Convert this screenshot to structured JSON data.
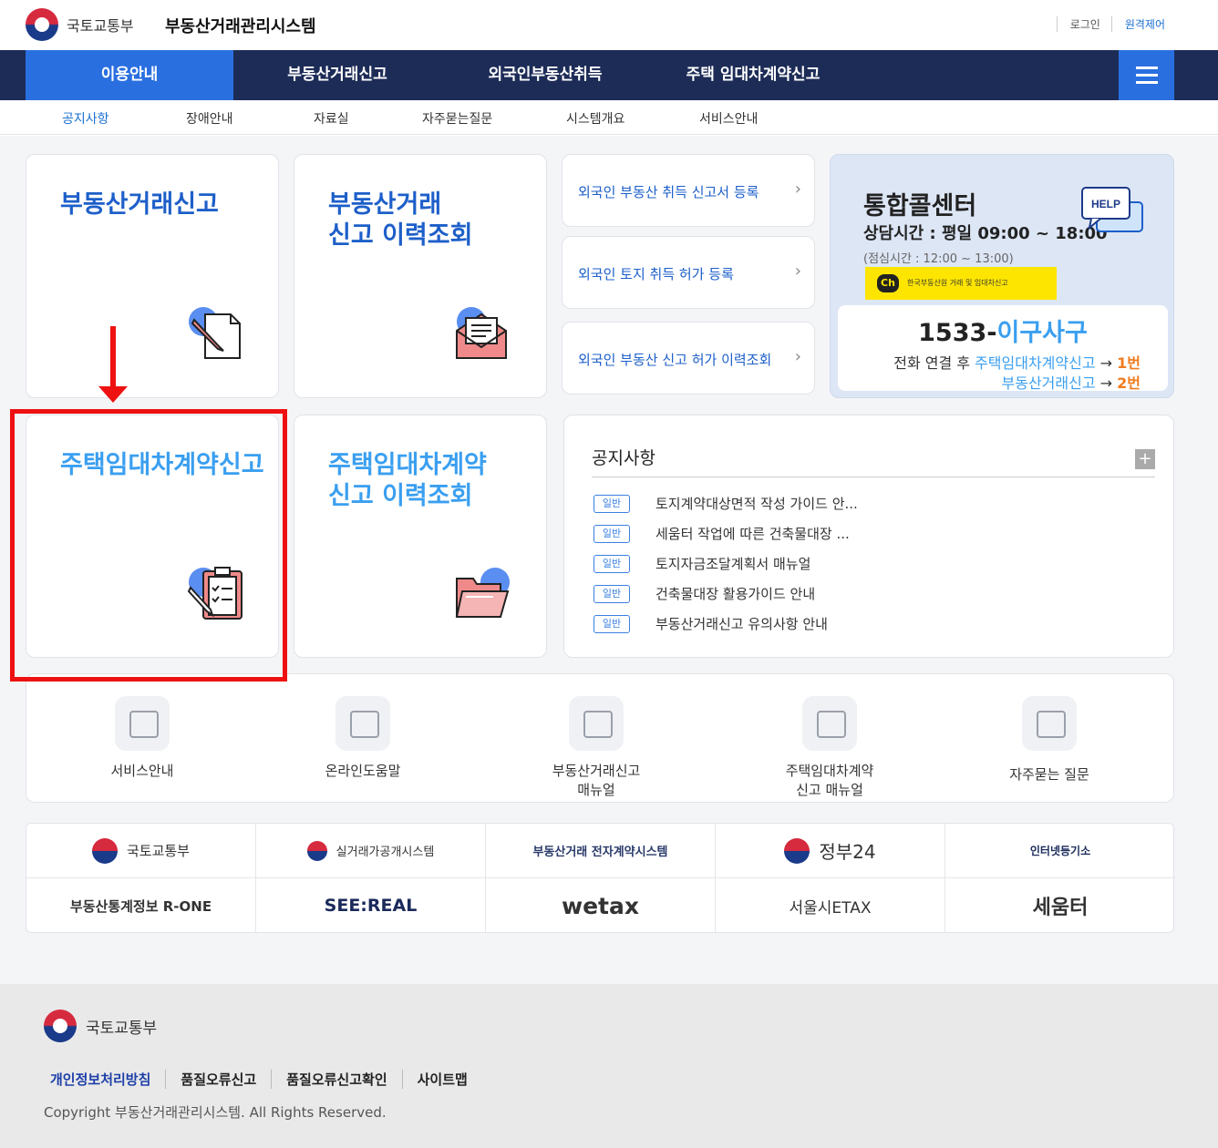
{
  "header": {
    "org_name": "국토교통부",
    "system_title": "부동산거래관리시스템",
    "login": "로그인",
    "remote": "원격제어"
  },
  "gnb": [
    "이용안내",
    "부동산거래신고",
    "외국인부동산취득",
    "주택 임대차계약신고"
  ],
  "lnb": [
    "공지사항",
    "장애안내",
    "자료실",
    "자주묻는질문",
    "시스템개요",
    "서비스안내"
  ],
  "cards": {
    "trade_report": "부동산거래신고",
    "trade_history": "부동산거래\n신고 이력조회",
    "lease_report": "주택임대차계약신고",
    "lease_history": "주택임대차계약\n신고 이력조회"
  },
  "links": [
    "외국인 부동산 취득 신고서 등록",
    "외국인 토지 취득 허가 등록",
    "외국인 부동산 신고 허가 이력조회"
  ],
  "callcenter": {
    "title": "통합콜센터",
    "hours": "상담시간 : 평일 09:00 ~ 18:00",
    "break": "(점심시간 : 12:00 ~ 13:00)",
    "help": "HELP",
    "kakao_badge": "Ch",
    "kakao_text": "한국부동산원 거래 및 임대차신고",
    "number_prefix": "1533-",
    "number_word": "이구사구",
    "line1_prefix": "전화 연결 후 ",
    "line1_service": "주택임대차계약신고",
    "line1_arrow": " → ",
    "line1_num": "1번",
    "line2_service": "부동산거래신고",
    "line2_arrow": " → ",
    "line2_num": "2번"
  },
  "notice": {
    "title": "공지사항",
    "more": "+",
    "items": [
      {
        "badge": "일반",
        "text": "토지계약대상면적 작성 가이드 안..."
      },
      {
        "badge": "일반",
        "text": "세움터 작업에 따른 건축물대장 ..."
      },
      {
        "badge": "일반",
        "text": "토지자금조달계획서 매뉴얼"
      },
      {
        "badge": "일반",
        "text": "건축물대장 활용가이드 안내"
      },
      {
        "badge": "일반",
        "text": "부동산거래신고 유의사항 안내"
      }
    ]
  },
  "quick": [
    "서비스안내",
    "온라인도움말",
    "부동산거래신고\n매뉴얼",
    "주택임대차계약\n신고 매뉴얼",
    "자주묻는 질문"
  ],
  "banners": [
    "국토교통부",
    "실거래가공개시스템",
    "부동산거래 전자계약시스템",
    "정부24",
    "인터넷등기소",
    "부동산통계정보 R-ONE",
    "SEE:REAL",
    "wetax",
    "서울시ETAX",
    "세움터"
  ],
  "footer": {
    "org_name": "국토교통부",
    "links": [
      "개인정보처리방침",
      "품질오류신고",
      "품질오류신고확인",
      "사이트맵"
    ],
    "copyright": "Copyright 부동산거래관리시스템. All Rights Reserved."
  }
}
